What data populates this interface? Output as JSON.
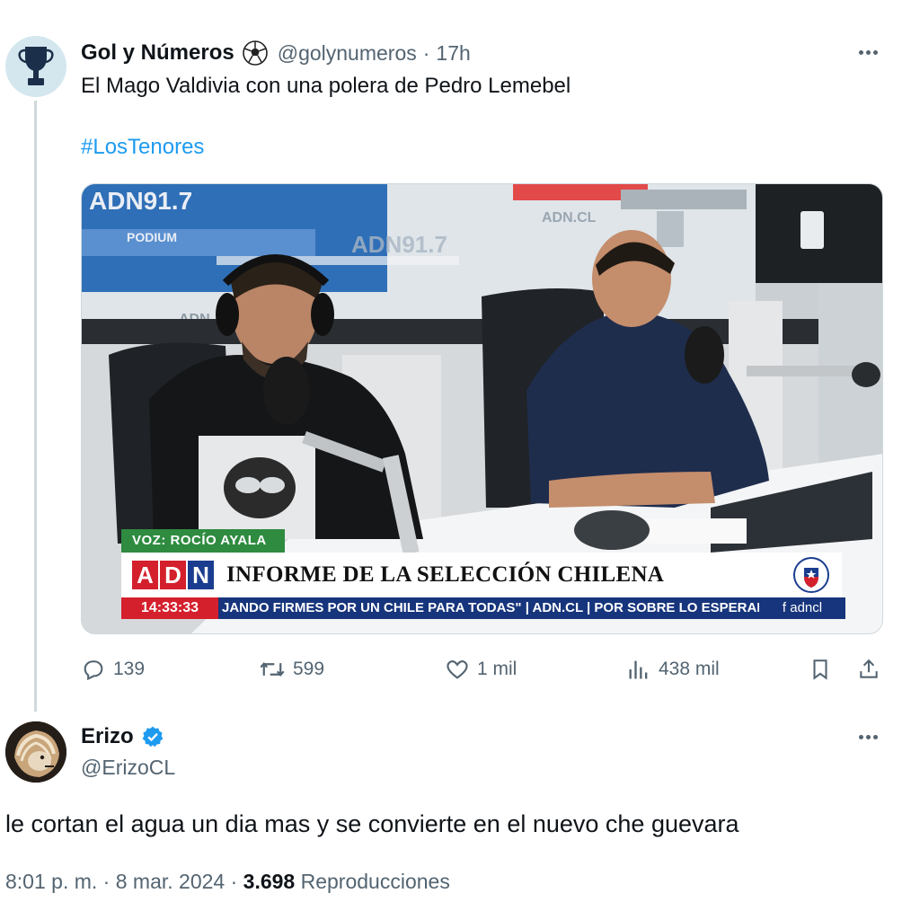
{
  "tweet": {
    "author_name": "Gol y Números",
    "handle": "@golynumeros",
    "separator": "·",
    "time": "17h",
    "text": "El Mago Valdivia con una polera de Pedro Lemebel",
    "hashtag": "#LosTenores",
    "media": {
      "wall_texts": [
        "ADN91.7",
        "PODIUM",
        "ADN91.7",
        "ADN.CL",
        "ADN"
      ],
      "voz_label": "VOZ: ROCÍO AYALA",
      "logo_letters": [
        "A",
        "D",
        "N"
      ],
      "headline": "INFORME DE LA SELECCIÓN CHILENA",
      "ticker_time": "14:33:33",
      "ticker_text": "JANDO FIRMES POR UN CHILE PARA TODAS\" | ADN.CL | POR SOBRE LO ESPERAD(",
      "ticker_social": "f  adncl"
    },
    "stats": {
      "replies": "139",
      "retweets": "599",
      "likes": "1 mil",
      "views": "438 mil"
    }
  },
  "reply": {
    "author_name": "Erizo",
    "handle": "@ErizoCL",
    "text": "le cortan el agua un dia mas y se convierte en el nuevo che guevara",
    "time": "8:01 p. m.",
    "date": "8 mar. 2024",
    "sep1": "·",
    "sep2": "·",
    "views_count": "3.698",
    "views_label": "Reproducciones"
  },
  "colors": {
    "accent": "#1d9bf0",
    "muted": "#536471",
    "adn_red": "#d4202c",
    "adn_blue": "#17357c",
    "voz_green": "#2e8b3f"
  },
  "icons": [
    "trophy-icon",
    "soccer-ball-icon",
    "more-icon",
    "reply-icon",
    "retweet-icon",
    "like-icon",
    "views-icon",
    "bookmark-icon",
    "share-icon",
    "verified-icon",
    "lion-avatar-icon",
    "chile-crest-icon"
  ]
}
